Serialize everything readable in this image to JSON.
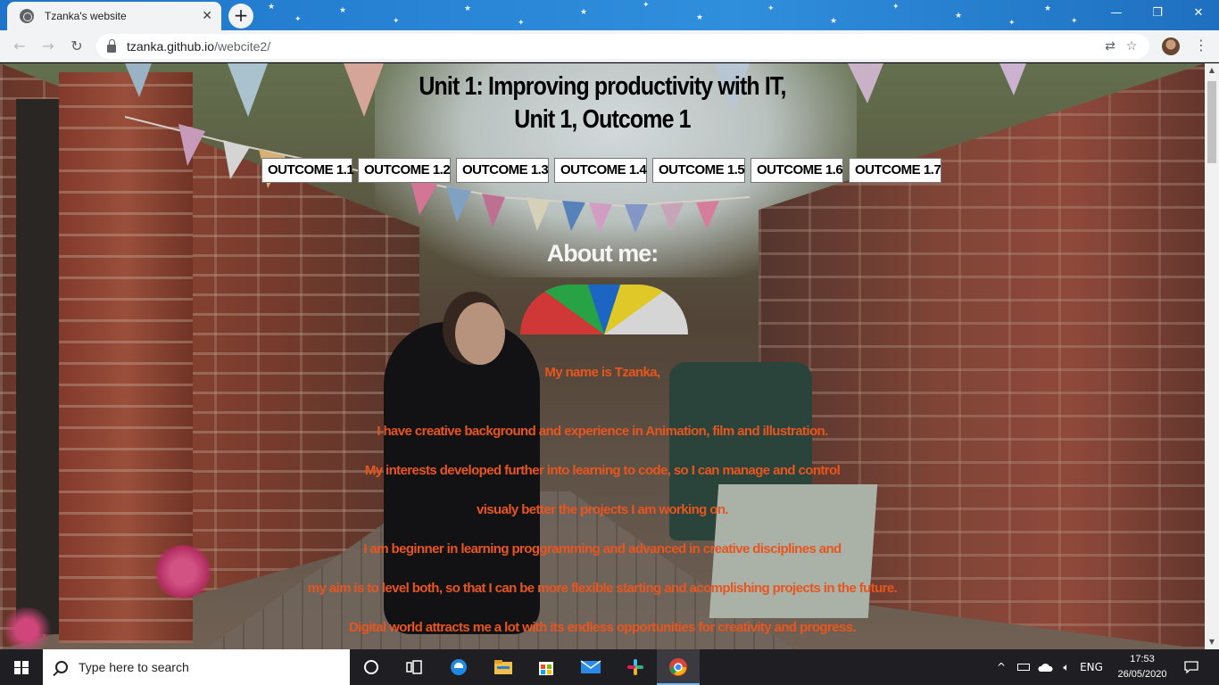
{
  "browser": {
    "tab_title": "Tzanka's website",
    "tab_close": "✕",
    "new_tab": "+",
    "url_host": "tzanka.github.io",
    "url_path": "/webcite2/",
    "back": "←",
    "forward": "→",
    "reload": "↻",
    "translate_icon": "⇄",
    "bookmark_icon": "☆",
    "menu_icon": "⋮",
    "window": {
      "minimize": "—",
      "maximize": "❐",
      "close": "✕"
    }
  },
  "page": {
    "heading_line1": "Unit 1: Improving productivity with IT,",
    "heading_line2": "Unit 1, Outcome 1",
    "outcomes": [
      "OUTCOME 1.1",
      "OUTCOME 1.2",
      "OUTCOME 1.3",
      "OUTCOME 1.4",
      "OUTCOME 1.5",
      "OUTCOME 1.6",
      "OUTCOME 1.7"
    ],
    "about_heading": "About me:",
    "paragraphs": [
      "My name is Tzanka,",
      "I have creative background and experience in Animation, film and illustration.",
      "My interests developed further into learning to code, so I can manage and control",
      "visualy better the projects I am working on.",
      "I am beginner in learning proggramming and advanced in creative disciplines and",
      "my aim is to level both, so that I can be more flexible starting and acomplishing projects in the future.",
      "Digital world attracts me a lot with its endless opportunities for creativity and progress."
    ],
    "text_color": "#e8551f"
  },
  "taskbar": {
    "search_placeholder": "Type here to search",
    "tray_chevron": "^",
    "language": "ENG",
    "time": "17:53",
    "date": "26/05/2020",
    "icons": [
      "cortana-icon",
      "task-view-icon",
      "edge-icon",
      "file-explorer-icon",
      "store-icon",
      "mail-icon",
      "slack-icon",
      "chrome-icon"
    ]
  },
  "colors": {
    "titlebar": "#2a86d6",
    "toolbar": "#f1f3f4",
    "taskbar": "#1f1f23",
    "active_indicator": "#79b7ef"
  }
}
